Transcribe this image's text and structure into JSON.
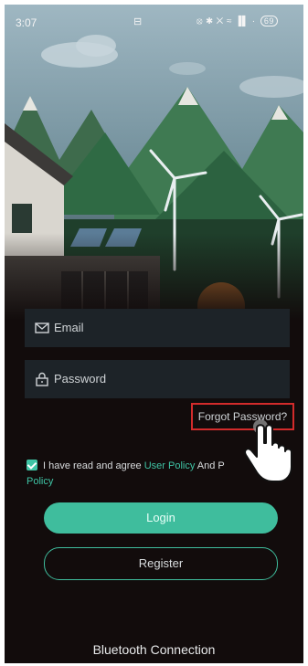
{
  "status_bar": {
    "time": "3:07",
    "mid_icon": "⊟",
    "icons_text": "⦻ ✱ ✕ ≈ ▐▌ · ",
    "battery": "69"
  },
  "login": {
    "email_placeholder": "Email",
    "password_placeholder": "Password",
    "forgot_password": "Forgot Password?",
    "agree_prefix": "I have read and agree ",
    "user_policy": "User Policy",
    "agree_and": " And P",
    "policy_tail": "Policy",
    "login_button": "Login",
    "register_button": "Register"
  },
  "footer": {
    "bluetooth": "Bluetooth Connection"
  },
  "colors": {
    "accent": "#3fbd9d",
    "highlight_border": "#d32b2b",
    "background": "#120c0c"
  },
  "icons": [
    "mail-icon",
    "lock-icon",
    "checkbox-checked-icon",
    "pointer-hand-icon"
  ]
}
